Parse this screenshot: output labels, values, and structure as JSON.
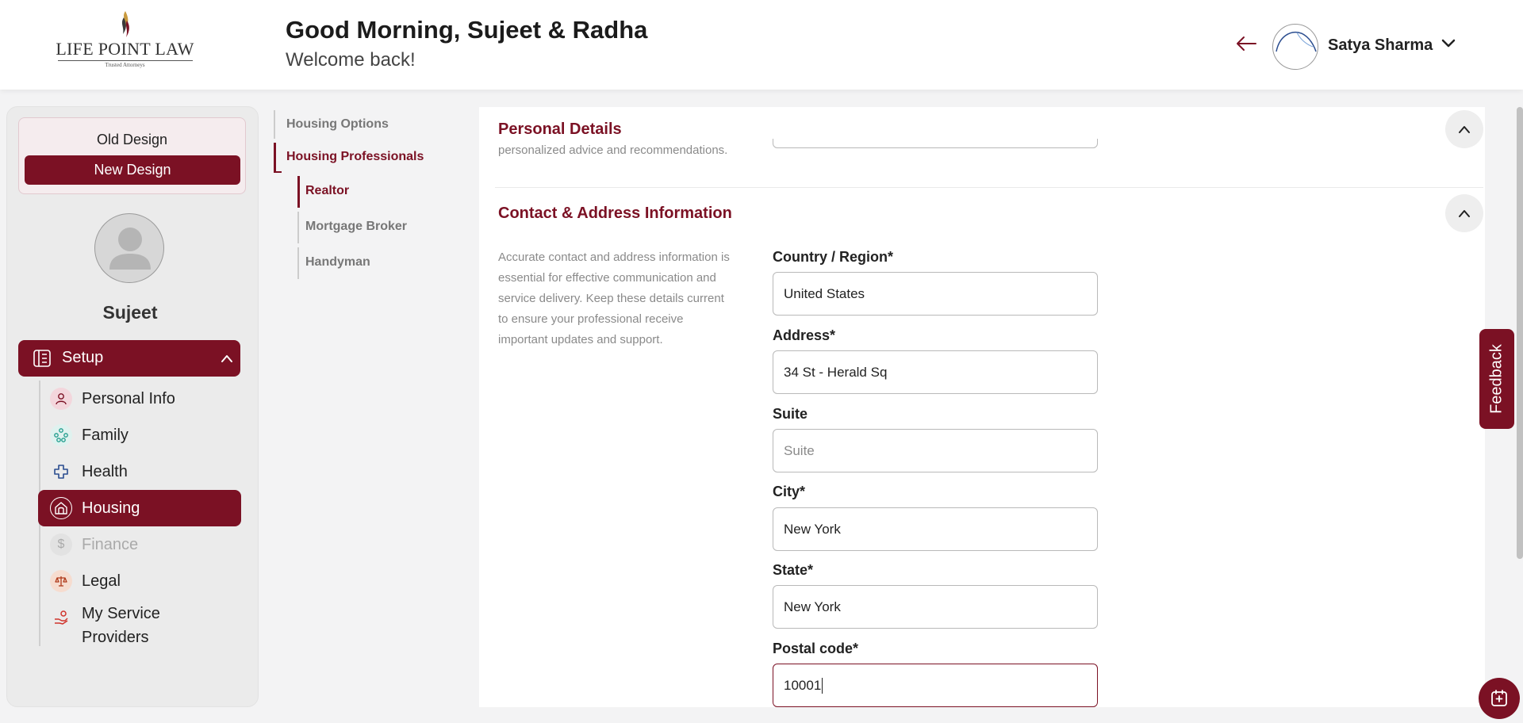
{
  "header": {
    "logo_name": "LIFE POINT LAW",
    "logo_tagline": "Trusted Attorneys",
    "greeting": "Good Morning, Sujeet & Radha",
    "welcome": "Welcome back!",
    "user_name": "Satya Sharma"
  },
  "sidebar": {
    "old_design": "Old Design",
    "new_design": "New Design",
    "profile_name": "Sujeet",
    "setup_label": "Setup",
    "items": [
      {
        "label": "Personal Info",
        "icon": "person-icon"
      },
      {
        "label": "Family",
        "icon": "family-icon"
      },
      {
        "label": "Health",
        "icon": "health-cross-icon"
      },
      {
        "label": "Housing",
        "icon": "home-icon",
        "active": true
      },
      {
        "label": "Finance",
        "icon": "dollar-icon",
        "disabled": true
      },
      {
        "label": "Legal",
        "icon": "scales-icon"
      },
      {
        "label": "My Service Providers",
        "icon": "service-providers-icon"
      }
    ]
  },
  "subnav": {
    "housing_options": "Housing Options",
    "housing_professionals": "Housing Professionals",
    "realtor": "Realtor",
    "mortgage_broker": "Mortgage Broker",
    "handyman": "Handyman"
  },
  "personal_details": {
    "title": "Personal Details",
    "partial_text": "personalized advice and recommendations."
  },
  "contact": {
    "title": "Contact & Address Information",
    "description": "Accurate contact and address information is essential for effective communication and service delivery. Keep these details current to ensure your professional receive important updates and support.",
    "country_label": "Country / Region*",
    "country_value": "United States",
    "address_label": "Address*",
    "address_value": "34 St - Herald Sq",
    "suite_label": "Suite",
    "suite_placeholder": "Suite",
    "city_label": "City*",
    "city_value": "New York",
    "state_label": "State*",
    "state_value": "New York",
    "postal_label": "Postal code*",
    "postal_value": "10001"
  },
  "feedback_label": "Feedback",
  "colors": {
    "brand": "#7b1124",
    "section_title": "#7b1124"
  }
}
